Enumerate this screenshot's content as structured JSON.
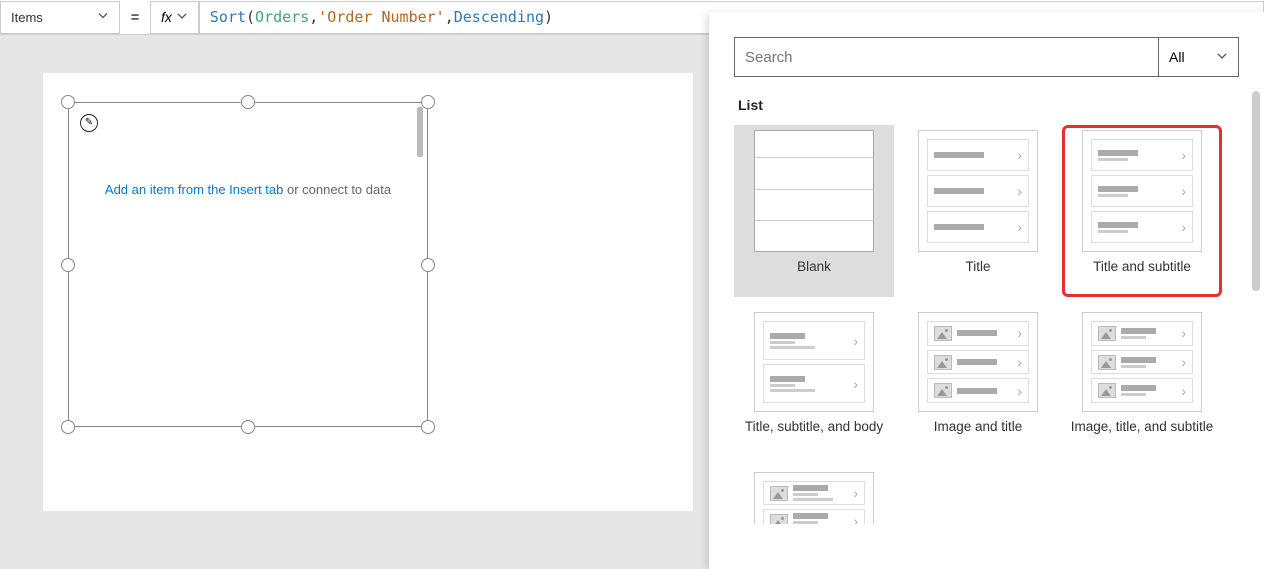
{
  "formula_bar": {
    "property_label": "Items",
    "fx_label": "fx",
    "equals": "=",
    "tokens": {
      "fn": "Sort",
      "open": "( ",
      "arg1": "Orders",
      "comma1": ", ",
      "arg2": "'Order Number'",
      "comma2": ", ",
      "arg3": "Descending",
      "close": " )"
    }
  },
  "canvas": {
    "placeholder_link": "Add an item from the Insert tab",
    "placeholder_plain": " or connect to data"
  },
  "layout_panel": {
    "search_placeholder": "Search",
    "filter_label": "All",
    "section": "List",
    "templates": [
      {
        "label": "Blank"
      },
      {
        "label": "Title"
      },
      {
        "label": "Title and subtitle"
      },
      {
        "label": "Title, subtitle, and body"
      },
      {
        "label": "Image and title"
      },
      {
        "label": "Image, title, and subtitle"
      }
    ]
  }
}
